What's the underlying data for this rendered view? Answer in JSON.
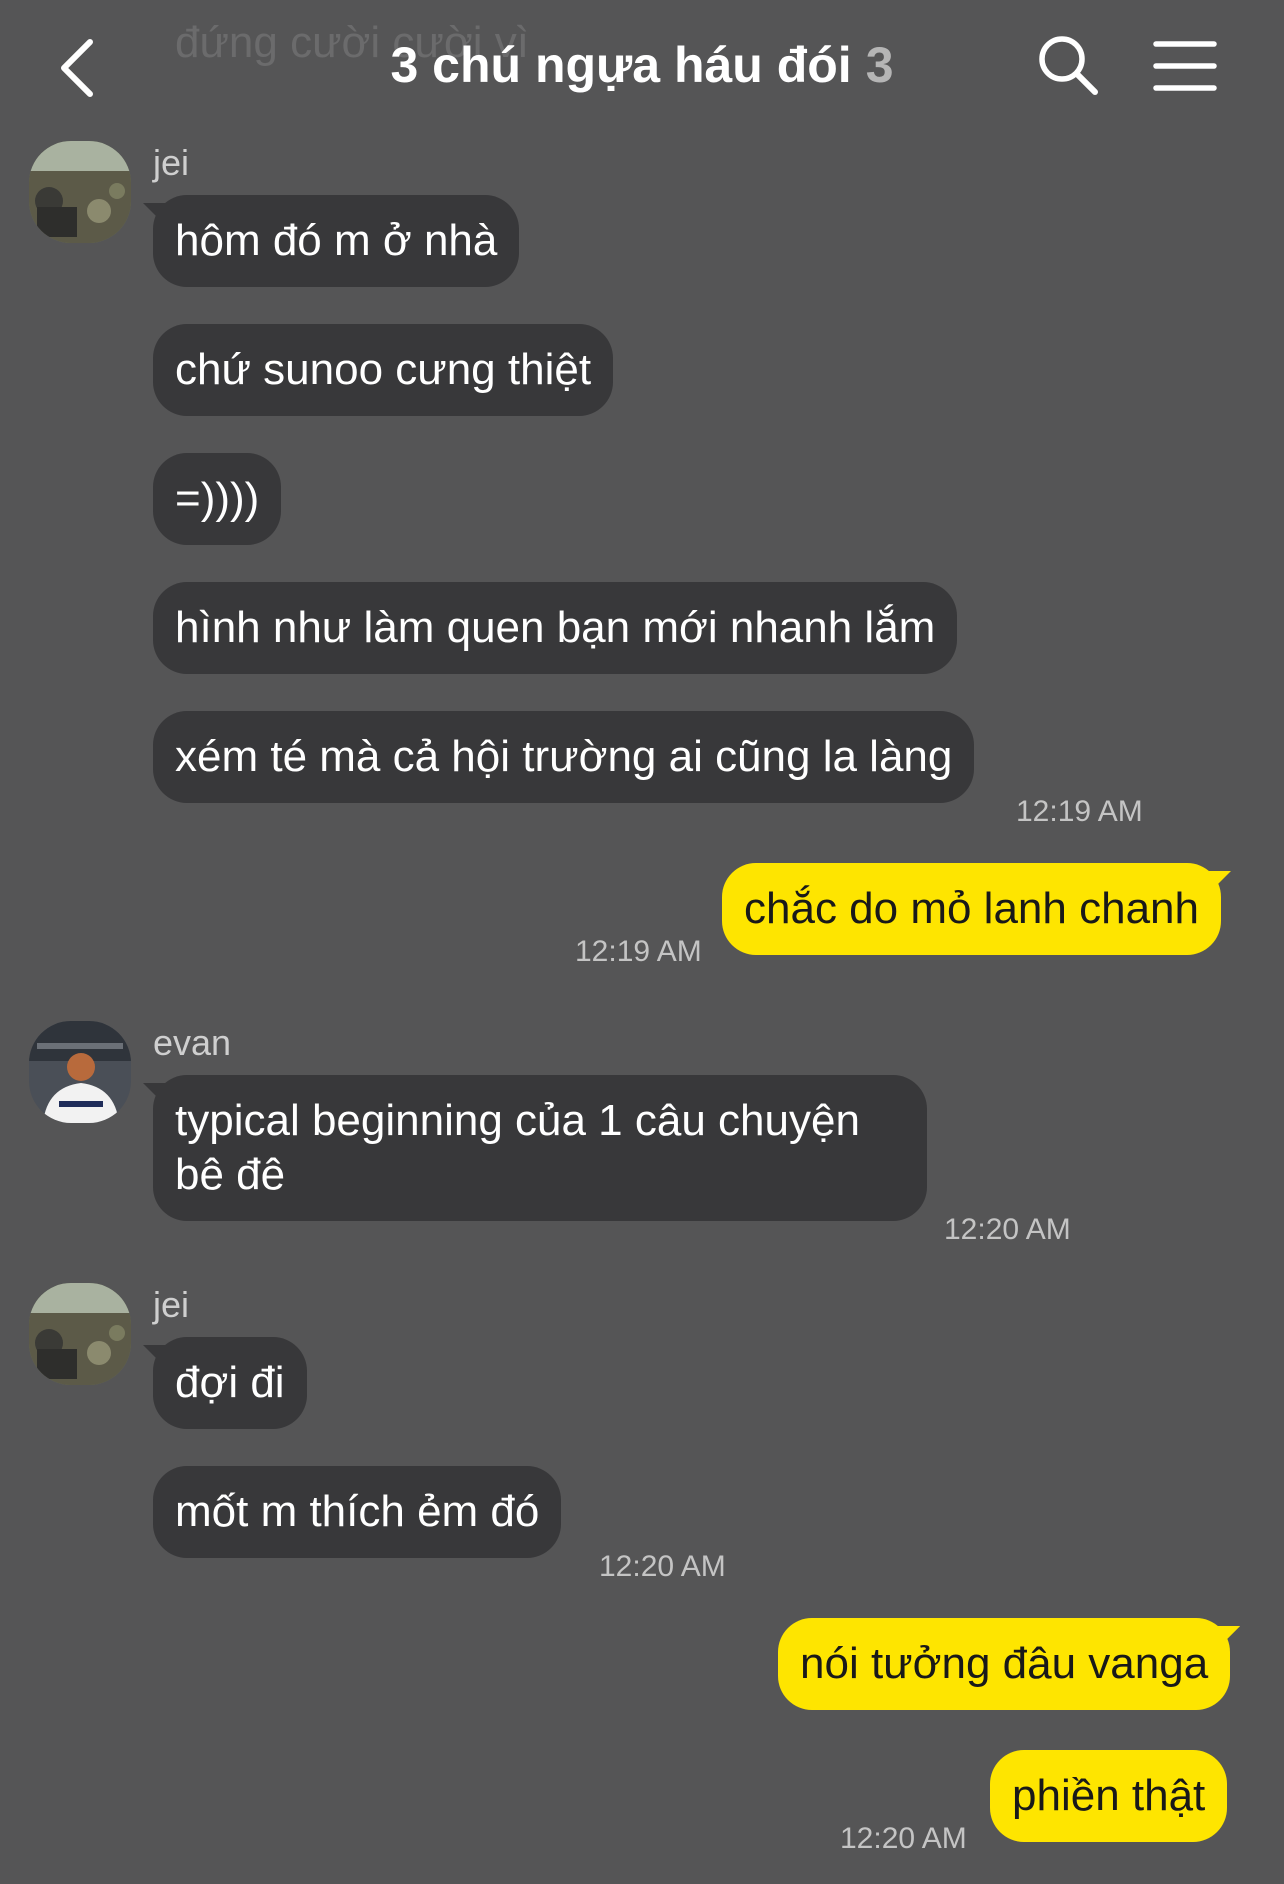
{
  "header": {
    "ghost_text": "đứng cười cười vì",
    "title": "3 chú ngựa háu đói",
    "member_count": "3"
  },
  "messages": [
    {
      "sender": "jei",
      "text": "hôm đó m ở nhà"
    },
    {
      "text": "chứ sunoo cưng thiệt"
    },
    {
      "text": "=))))"
    },
    {
      "text": "hình như làm quen bạn mới nhanh lắm"
    },
    {
      "text": "xém té mà cả hội trường ai cũng la làng",
      "time": "12:19 AM"
    },
    {
      "mine": true,
      "text": "chắc do mỏ lanh chanh",
      "time": "12:19 AM"
    },
    {
      "sender": "evan",
      "text": "typical beginning của 1 câu chuyện bê đê",
      "time": "12:20 AM"
    },
    {
      "sender": "jei",
      "text": "đợi đi"
    },
    {
      "text": "mốt m thích ẻm đó",
      "time": "12:20 AM"
    },
    {
      "mine": true,
      "text": "nói tưởng đâu vanga"
    },
    {
      "mine": true,
      "text": "phiền thật",
      "time": "12:20 AM"
    }
  ],
  "colors": {
    "background": "#555556",
    "incoming_bubble": "#38383a",
    "outgoing_bubble": "#fee500"
  },
  "icons": [
    "back-icon",
    "search-icon",
    "menu-icon"
  ]
}
